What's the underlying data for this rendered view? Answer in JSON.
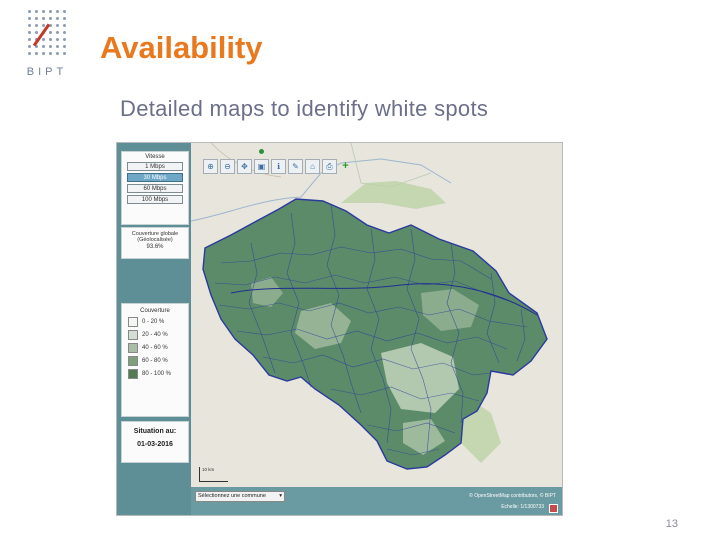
{
  "slide": {
    "logo_text": "BIPT",
    "title": "Availability",
    "subtitle": "Detailed maps to identify white spots",
    "page_number": "13"
  },
  "app": {
    "speed_panel": {
      "title": "Vitesse",
      "buttons": [
        {
          "label": "1 Mbps",
          "active": false
        },
        {
          "label": "30 Mbps",
          "active": true
        },
        {
          "label": "60 Mbps",
          "active": false
        },
        {
          "label": "100 Mbps",
          "active": false
        }
      ]
    },
    "coverage_panel": {
      "label": "Couverture globale (Géolocalisée)",
      "value": "93.6%"
    },
    "legend": {
      "title": "Couverture",
      "items": [
        {
          "label": "0 - 20 %",
          "color": "#f4f6f4"
        },
        {
          "label": "20 - 40 %",
          "color": "#d4ddd4"
        },
        {
          "label": "40 - 60 %",
          "color": "#a9bea9"
        },
        {
          "label": "60 - 80 %",
          "color": "#7f9f7f"
        },
        {
          "label": "80 - 100 %",
          "color": "#547a54"
        }
      ]
    },
    "situation": {
      "label": "Situation au:",
      "date": "01-03-2016"
    },
    "map": {
      "toolbar_icons": [
        "zoom-in-icon",
        "zoom-out-icon",
        "pan-icon",
        "select-icon",
        "info-icon",
        "measure-icon",
        "home-icon",
        "print-icon",
        "add-icon"
      ],
      "scale_label": "10 km",
      "fill_color": "#5c8b6a",
      "border_color": "#2a3a9c"
    },
    "bottom": {
      "select_value": "Sélectionnez une commune",
      "copyright": "© OpenStreetMap contributors, © BIPT",
      "scale_text": "Echelle: 1/1300733"
    }
  }
}
